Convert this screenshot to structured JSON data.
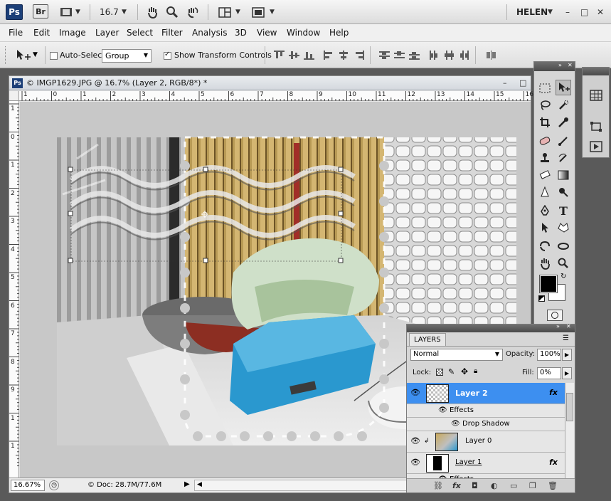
{
  "appbar": {
    "ps": "Ps",
    "br": "Br",
    "zoom": "16.7",
    "user": "HELEN",
    "min": "–",
    "max": "□",
    "close": "✕"
  },
  "menu": [
    "File",
    "Edit",
    "Image",
    "Layer",
    "Select",
    "Filter",
    "Analysis",
    "3D",
    "View",
    "Window",
    "Help"
  ],
  "options": {
    "auto_select_label": "Auto-Select:",
    "auto_select_value": "Group",
    "show_transform_label": "Show Transform Controls"
  },
  "document": {
    "title": "© IMGP1629.JPG @ 16.7% (Layer 2, RGB/8*) *",
    "ruler_h": [
      "1",
      "0",
      "1",
      "2",
      "3",
      "4",
      "5",
      "6",
      "7",
      "8",
      "9",
      "10",
      "11",
      "12",
      "13",
      "14",
      "15",
      "16"
    ],
    "ruler_v": [
      "1",
      "0",
      "1",
      "2",
      "3",
      "4",
      "5",
      "6",
      "7",
      "8",
      "9",
      "1",
      "1"
    ],
    "zoom": "16.67%",
    "doc_info": "© Doc: 28.7M/77.6M"
  },
  "layers": {
    "tab": "LAYERS",
    "blend_mode": "Normal",
    "opacity_label": "Opacity:",
    "opacity": "100%",
    "lock_label": "Lock:",
    "fill_label": "Fill:",
    "fill": "0%",
    "items": [
      {
        "name": "Layer 2",
        "fx": "fx"
      },
      {
        "name": "Effects"
      },
      {
        "name": "Drop Shadow"
      },
      {
        "name": "Layer 0"
      },
      {
        "name": "Layer 1",
        "fx": "fx"
      },
      {
        "name": "Effects"
      }
    ]
  },
  "colors": {
    "selection": "#3d8ff0",
    "panel_head": "#565656"
  }
}
